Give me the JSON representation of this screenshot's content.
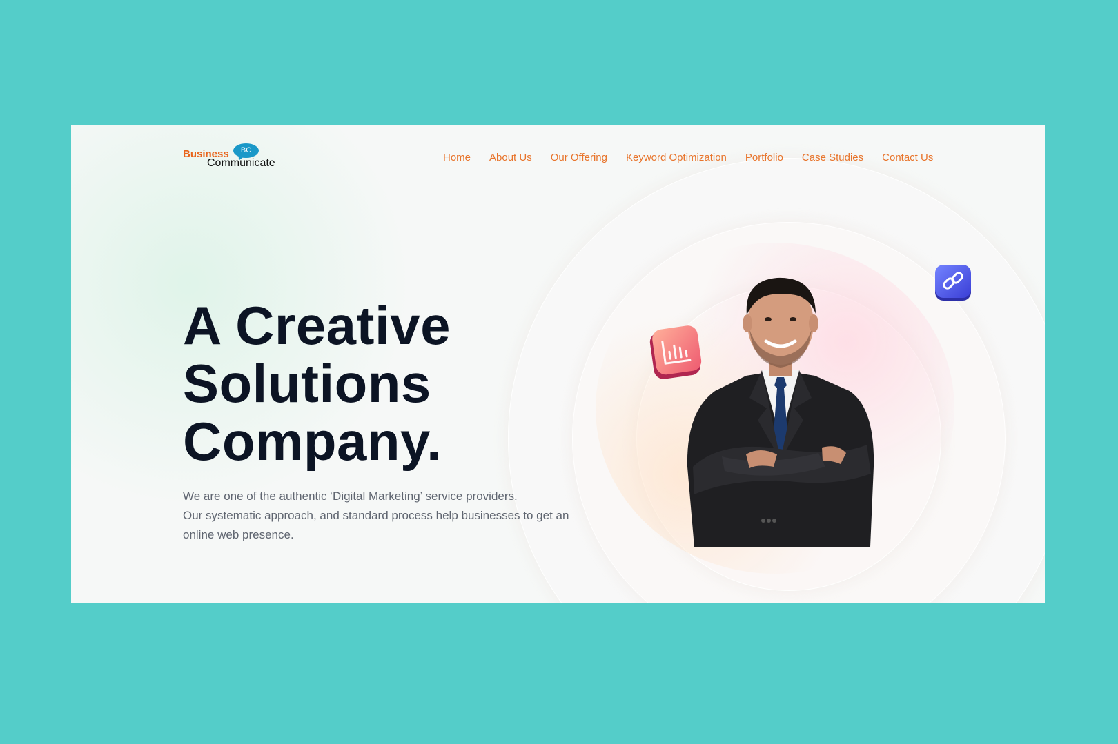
{
  "brand": {
    "word1": "Business",
    "badge": "BC",
    "word2": "Communicate"
  },
  "nav": {
    "items": [
      {
        "label": "Home"
      },
      {
        "label": "About Us"
      },
      {
        "label": "Our Offering"
      },
      {
        "label": "Keyword Optimization"
      },
      {
        "label": "Portfolio"
      },
      {
        "label": "Case Studies"
      },
      {
        "label": "Contact Us"
      }
    ]
  },
  "hero": {
    "title_lines": [
      "A Creative",
      "Solutions",
      "Company."
    ],
    "description_lines": [
      "We are one of the authentic ‘Digital Marketing’ service providers.",
      "Our systematic approach, and standard process help businesses to get an",
      "online web presence."
    ]
  },
  "icons": {
    "chart": "bar-chart-icon",
    "link": "link-icon"
  },
  "colors": {
    "background": "#54cdc9",
    "nav_text": "#e8742b",
    "brand_orange": "#e8631a",
    "brand_blue": "#1a98c8",
    "title": "#0c1424",
    "body_text": "#5f6570",
    "chart_icon_gradient": [
      "#ff9a8b",
      "#e8455f"
    ],
    "link_icon_gradient": [
      "#6a78ff",
      "#3b3fd8"
    ]
  }
}
